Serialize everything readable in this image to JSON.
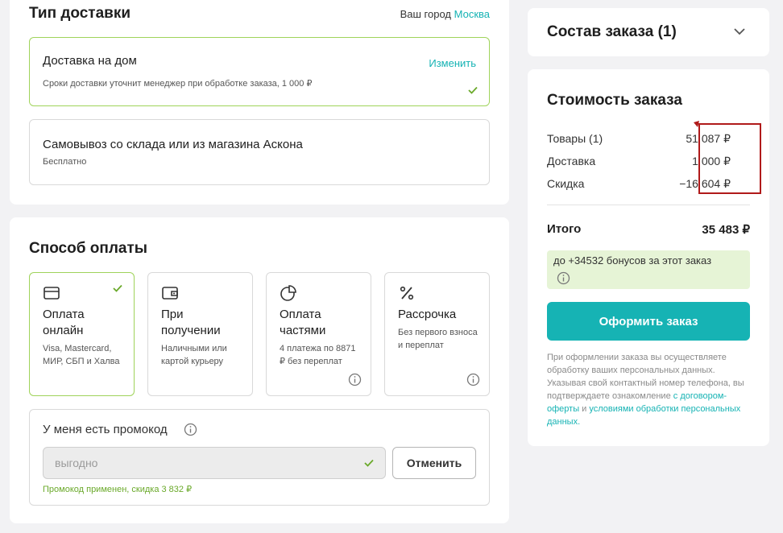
{
  "delivery": {
    "title": "Тип доставки",
    "city_label": "Ваш город",
    "city": "Москва",
    "options": [
      {
        "title": "Доставка на дом",
        "subtitle": "Сроки доставки уточнит менеджер при обработке заказа, 1 000 ₽",
        "action": "Изменить",
        "selected": true
      },
      {
        "title": "Самовывоз со склада или из магазина Аскона",
        "subtitle": "Бесплатно",
        "selected": false
      }
    ]
  },
  "payment": {
    "title": "Способ оплаты",
    "methods": [
      {
        "title": "Оплата онлайн",
        "description": "Visa, Mastercard, МИР, СБП и Халва",
        "icon": "card-icon",
        "selected": true
      },
      {
        "title": "При получении",
        "description": "Наличными или картой курьеру",
        "icon": "wallet-icon",
        "selected": false
      },
      {
        "title": "Оплата частями",
        "description": "4 платежа по 8871 ₽ без переплат",
        "icon": "pie-chart-icon",
        "selected": false,
        "has_info": true
      },
      {
        "title": "Рассрочка",
        "description": "Без первого взноса и переплат",
        "icon": "percent-icon",
        "selected": false,
        "has_info": true
      }
    ]
  },
  "promo": {
    "label": "У меня есть промокод",
    "value": "выгодно",
    "cancel_label": "Отменить",
    "note": "Промокод применен, скидка 3 832 ₽"
  },
  "composition": {
    "title": "Состав заказа (1)"
  },
  "cost": {
    "title": "Стоимость заказа",
    "rows": [
      {
        "label": "Товары (1)",
        "value": "51 087 ₽"
      },
      {
        "label": "Доставка",
        "value": "1 000 ₽"
      },
      {
        "label": "Скидка",
        "value": "−16 604 ₽"
      }
    ],
    "total_label": "Итого",
    "total_value": "35 483 ₽",
    "bonus_text": "до +34532 бонусов за этот заказ",
    "checkout_label": "Оформить заказ",
    "disclaimer_text": "При оформлении заказа вы осуществляете обработку ваших персональных данных. Указывая свой контактный номер телефона, вы подтверждаете ознакомление",
    "disclaimer_link1": "с договором-оферты",
    "disclaimer_and": " и ",
    "disclaimer_link2": "условиями обработки персональных данных",
    "disclaimer_end": "."
  },
  "colors": {
    "accent": "#16b3b4",
    "selected_border": "#9fd35a",
    "check": "#6aa92a",
    "bonus_bg": "#e6f4d6",
    "annotation": "#b01a1a"
  }
}
